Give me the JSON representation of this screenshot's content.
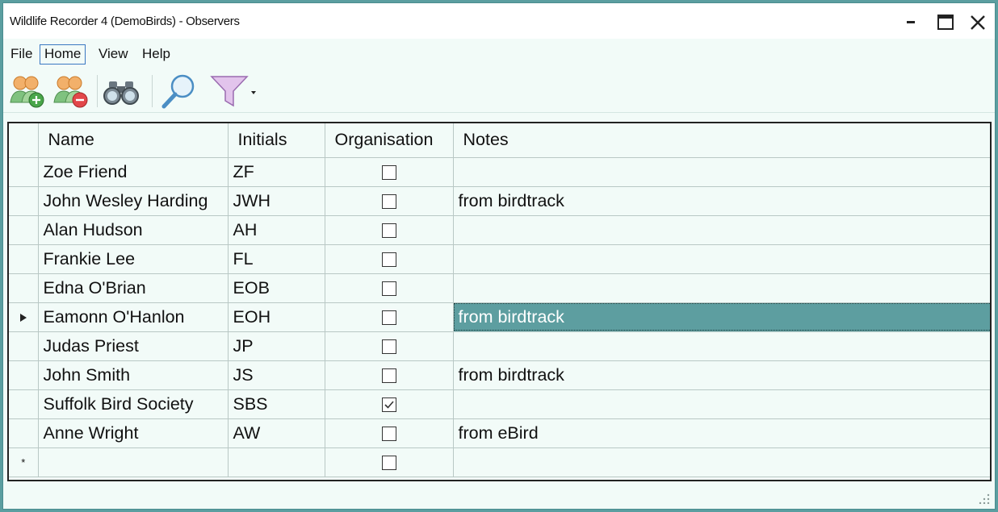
{
  "window": {
    "title": "Wildlife Recorder 4 (DemoBirds) - Observers"
  },
  "menu": [
    "File",
    "Home",
    "View",
    "Help"
  ],
  "toolbar": [
    "add-observer-icon",
    "remove-observer-icon",
    "binoculars-icon",
    "search-icon",
    "filter-icon"
  ],
  "colors": {
    "frame": "#5b9ea0",
    "background": "#f2fbf8",
    "selection": "#5d9ea0"
  },
  "grid": {
    "columns": [
      "Name",
      "Initials",
      "Organisation",
      "Notes"
    ],
    "rows": [
      {
        "name": "Zoe Friend",
        "initials": "ZF",
        "organisation": false,
        "notes": ""
      },
      {
        "name": "John Wesley Harding",
        "initials": "JWH",
        "organisation": false,
        "notes": "from birdtrack"
      },
      {
        "name": "Alan Hudson",
        "initials": "AH",
        "organisation": false,
        "notes": ""
      },
      {
        "name": "Frankie Lee",
        "initials": "FL",
        "organisation": false,
        "notes": ""
      },
      {
        "name": "Edna O'Brian",
        "initials": "EOB",
        "organisation": false,
        "notes": ""
      },
      {
        "name": "Eamonn O'Hanlon",
        "initials": "EOH",
        "organisation": false,
        "notes": "from birdtrack",
        "current": true
      },
      {
        "name": "Judas Priest",
        "initials": "JP",
        "organisation": false,
        "notes": ""
      },
      {
        "name": "John Smith",
        "initials": "JS",
        "organisation": false,
        "notes": "from birdtrack"
      },
      {
        "name": "Suffolk Bird Society",
        "initials": "SBS",
        "organisation": true,
        "notes": ""
      },
      {
        "name": "Anne Wright",
        "initials": "AW",
        "organisation": false,
        "notes": "from eBird"
      }
    ],
    "new_row_marker": "*"
  }
}
